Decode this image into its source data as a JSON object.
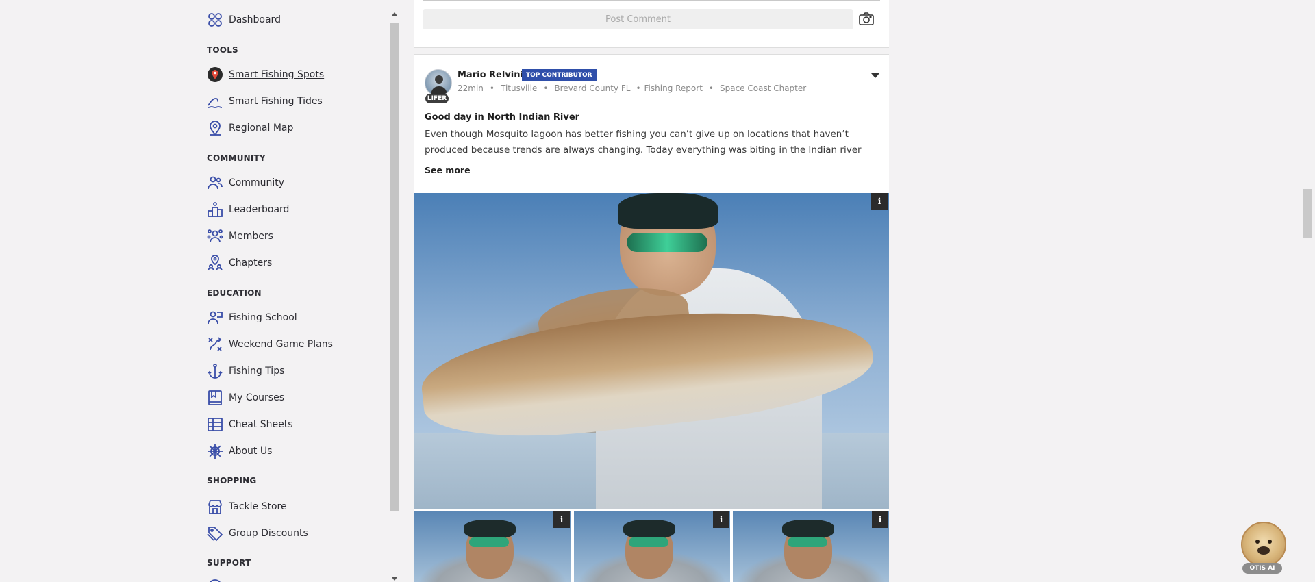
{
  "sidebar": {
    "dashboard": "Dashboard",
    "sections": [
      {
        "heading": "TOOLS",
        "items": [
          "Smart Fishing Spots",
          "Smart Fishing Tides",
          "Regional Map"
        ]
      },
      {
        "heading": "COMMUNITY",
        "items": [
          "Community",
          "Leaderboard",
          "Members",
          "Chapters"
        ]
      },
      {
        "heading": "EDUCATION",
        "items": [
          "Fishing School",
          "Weekend Game Plans",
          "Fishing Tips",
          "My Courses",
          "Cheat Sheets",
          "About Us"
        ]
      },
      {
        "heading": "SHOPPING",
        "items": [
          "Tackle Store",
          "Group Discounts"
        ]
      },
      {
        "heading": "SUPPORT",
        "items": []
      }
    ],
    "icons": {
      "dashboard": "grid-icon",
      "spots": "map-pin-badge-icon",
      "tides": "wave-icon",
      "regional": "location-icon",
      "community": "people-icon",
      "leaderboard": "podium-icon",
      "members": "members-icon",
      "chapters": "chapter-pin-icon",
      "school": "school-icon",
      "plans": "strategy-icon",
      "tips": "anchor-icon",
      "courses": "book-icon",
      "cheat": "table-icon",
      "about": "ship-wheel-icon",
      "store": "store-icon",
      "discounts": "tag-icon"
    },
    "accent_color": "#3a4ea8"
  },
  "comment_box": {
    "post_button": "Post Comment",
    "camera_icon": "camera-icon"
  },
  "post": {
    "author": "Mario Relvini",
    "badge": "TOP CONTRIBUTOR",
    "avatar_label": "LIFER",
    "time": "22min",
    "city": "Titusville",
    "county": "Brevard County FL",
    "category": "Fishing Report",
    "chapter": "Space Coast Chapter",
    "title": "Good day in North Indian River",
    "body": "Even though Mosquito lagoon has better fishing you can’t give up on locations that haven’t produced because trends are always changing. Today everything was biting in the Indian river",
    "see_more": "See more",
    "info_label": "i",
    "badge_color": "#2f4faa"
  },
  "assistant": {
    "label": "OTIS AI"
  }
}
